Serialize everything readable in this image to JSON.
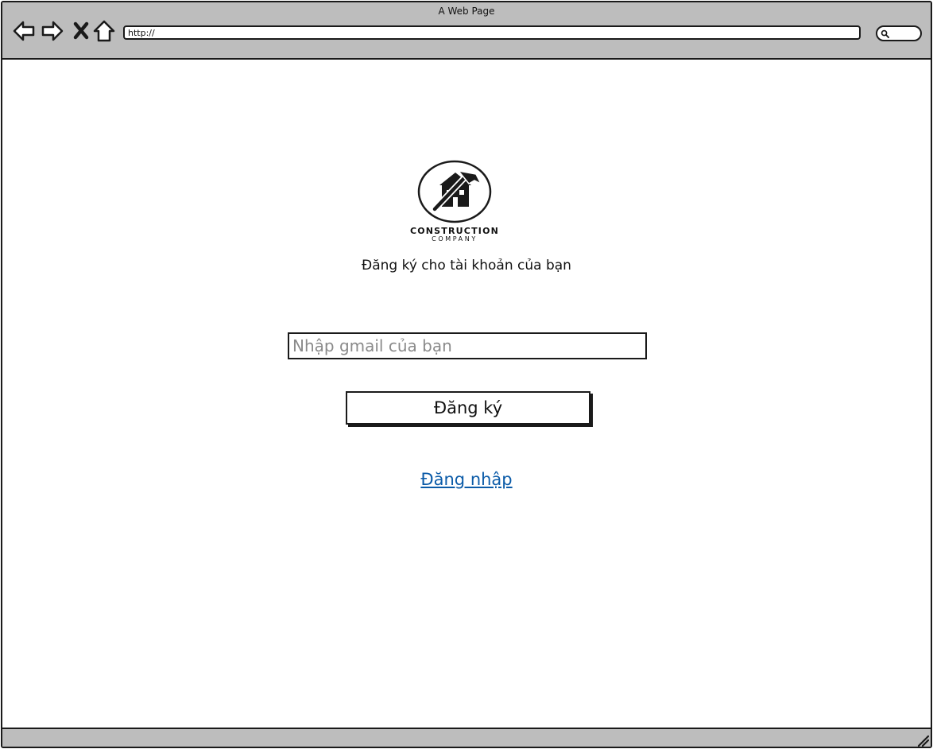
{
  "window": {
    "title": "A Web Page"
  },
  "toolbar": {
    "back_icon": "arrow-left-icon",
    "forward_icon": "arrow-right-icon",
    "stop_icon": "close-icon",
    "home_icon": "home-icon",
    "address": "http://",
    "search_icon": "search-icon"
  },
  "logo": {
    "main_text": "CONSTRUCTION",
    "sub_text": "COMPANY",
    "icon": "house-hammer-icon"
  },
  "form": {
    "heading": "Đăng ký cho tài khoản của bạn",
    "email_placeholder": "Nhập gmail của bạn",
    "submit_label": "Đăng ký",
    "login_link": "Đăng nhập"
  },
  "colors": {
    "chrome": "#bdbdbd",
    "border": "#1a1a1a",
    "link": "#0b5ba8",
    "placeholder": "#8a8a8a"
  }
}
